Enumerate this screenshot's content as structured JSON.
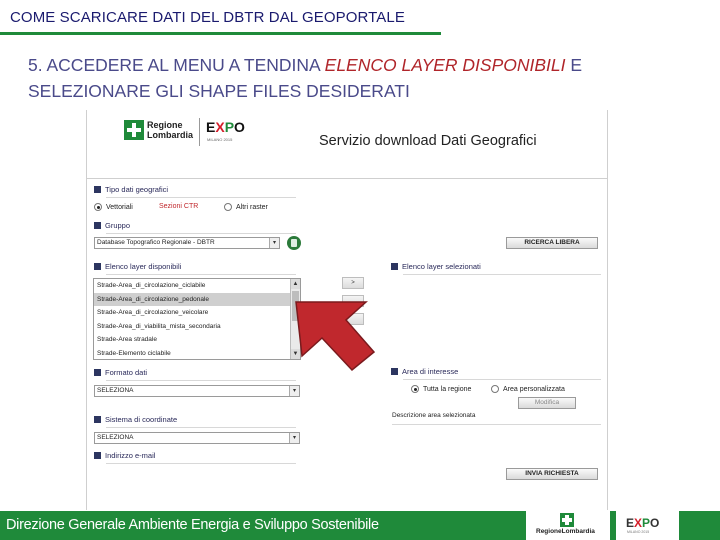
{
  "slide": {
    "title": "COME SCARICARE DATI DEL DBTR DAL GEOPORTALE",
    "step_prefix": "5.   ACCEDERE AL MENU A TENDINA ",
    "step_highlight": "ELENCO LAYER DISPONIBILI",
    "step_suffix": " E SELEZIONARE GLI SHAPE FILES DESIDERATI"
  },
  "app": {
    "logo_text": "Regione Lombardia",
    "expo_logo": [
      "E",
      "X",
      "P",
      "O"
    ],
    "expo_sub": "MILANO 2015",
    "service_title": "Servizio download Dati Geografici",
    "tipo_dati": {
      "header": "Tipo dati geografici",
      "options": [
        "Vettoriali",
        "Sezioni CTR",
        "Altri raster"
      ],
      "selected": "Vettoriali"
    },
    "gruppo": {
      "header": "Gruppo",
      "selected": "Database Topografico Regionale - DBTR"
    },
    "ricerca_button": "RICERCA LIBERA",
    "elenco_disponibili": {
      "header": "Elenco layer disponibili",
      "items": [
        "Strade-Area_di_circolazione_ciclabile",
        "Strade-Area_di_circolazione_pedonale",
        "Strade-Area_di_circolazione_veicolare",
        "Strade-Area_di_viabilita_mista_secondaria",
        "Strade-Area stradale",
        "Strade-Elemento ciclabile"
      ],
      "selected_index": 1
    },
    "move_button": ">",
    "elenco_selezionati": {
      "header": "Elenco layer selezionati"
    },
    "formato": {
      "header": "Formato dati",
      "selected": "SELEZIONA"
    },
    "area": {
      "header": "Area di interesse",
      "options": [
        "Tutta la regione",
        "Area personalizzata"
      ],
      "selected": "Tutta la regione",
      "modify_button": "Modifica",
      "description_label": "Descrizione area selezionata"
    },
    "coordinate": {
      "header": "Sistema di coordinate",
      "selected": "SELEZIONA"
    },
    "email": {
      "header": "Indirizzo e-mail"
    },
    "submit_button": "INVIA RICHIESTA"
  },
  "footer": {
    "text": "Direzione Generale Ambiente Energia e Sviluppo Sostenibile",
    "logo1_label": "RegioneLombardia",
    "logo2_text": [
      "E",
      "X",
      "P",
      "O"
    ],
    "logo2_sub": "MILANO 2015"
  },
  "colors": {
    "brand_green": "#1f8a3a",
    "accent_red": "#c0282d",
    "title_blue": "#1a1a6e",
    "arrow_red": "#c0282d"
  }
}
